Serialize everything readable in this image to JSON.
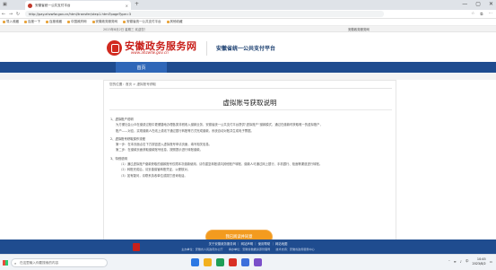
{
  "browser": {
    "tab_title": "安徽省统一公共支付平台",
    "tab_close": "×",
    "new_tab": "+",
    "window_controls": [
      "—",
      "▢",
      "✕"
    ],
    "url": "http://pay.ahzwfw.gov.cn/html/transfer/step1.html?pageType=3",
    "bookmarks": [
      "导入收藏",
      "百度一下",
      "百度收藏",
      "中国政府网",
      "安徽政务服务网",
      "安徽省统一公共支付平台",
      "其他收藏"
    ]
  },
  "site": {
    "date_line": "2023年8月2日 星期三 欢迎您！",
    "portal_link": "安徽政务服务网",
    "logo_name": "安徽政务服务网",
    "logo_url": "www.ahzwfw.gov.cn",
    "platform_name": "安徽省统一公共支付平台",
    "nav_home": "首页",
    "breadcrumb": "您的位置：首页 > 虚拟账号获取",
    "page_title": "虚拟账号获取说明",
    "body_lines": [
      {
        "cls": "sec",
        "text": "1、虚拟账户说明"
      },
      {
        "cls": "ind",
        "text": "为方便社会公众在缴费过程中更便捷地办理各类非税收入缴款业务，安徽省统一公共支付平台提供“虚拟账户”缴款模式，通过在缴款时获取唯一的虚拟账户，"
      },
      {
        "cls": "ind",
        "text": "账户——对应，实现缴款人在线上或线下通过银行转账等方式完成缴款，系统自动对账并生成电子票据。"
      },
      {
        "cls": "sec",
        "text": "2、虚拟账号获取操作流程"
      },
      {
        "cls": "ind",
        "text": "第一步：在本页面点击下方按钮进入虚拟账号申请页面，填写相关信息。"
      },
      {
        "cls": "ind",
        "text": "第二步：在缴款页面获取缴款账号信息，按照提示进行转账缴款。"
      },
      {
        "cls": "sec",
        "text": "3、特别说明"
      },
      {
        "cls": "ind2",
        "text": "（1）通过虚拟账户缴款获取的缴款账号仅限本次缴款使用，请勿重复转账或向其他账户转账，缴款人可通过网上银行、手机银行、柜面等渠道进行转账。"
      },
      {
        "cls": "ind2",
        "text": "（2）转账完成后，请妥善保管转账凭证，以便核对。"
      },
      {
        "cls": "ind2",
        "text": "（3）如有疑问，请联系执收单位或拨打咨询电话。"
      }
    ],
    "cta_label": "我已阅读并同意",
    "footer_row1": "关于安徽政务服务网 ｜ 网站声明 ｜ 使用帮助 ｜ 网站地图",
    "footer_row2": "主办单位：安徽省人民政府办公厅　　承办单位：安徽省数据资源管理局　　技术支持：安徽省政务服务中心"
  },
  "taskbar": {
    "search_placeholder": "在这里输入你要搜索的内容",
    "lang": "中",
    "time": "10:45",
    "date": "2023/8/2",
    "icon_colors": [
      "#2b78e4",
      "#f2b01e",
      "#1e9e57",
      "#d93025",
      "#3d6fdb",
      "#7a4fc9"
    ]
  }
}
